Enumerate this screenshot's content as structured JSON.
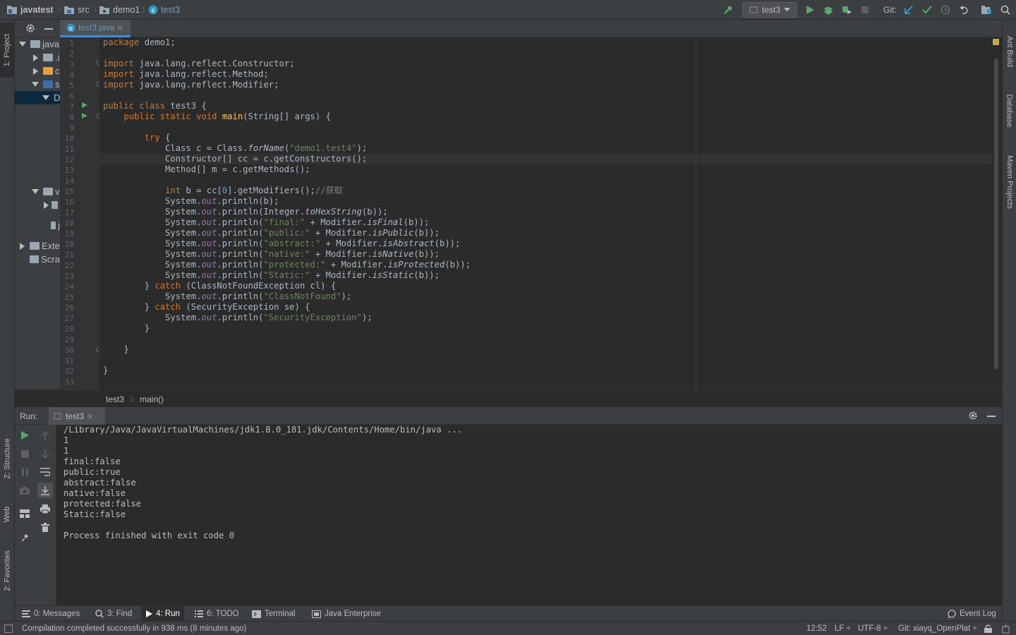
{
  "navbar": {
    "breadcrumbs": [
      "javatest",
      "src",
      "demo1",
      "test3"
    ],
    "run_config": "test3",
    "git_label": "Git:"
  },
  "left_tool_tabs": {
    "project": "1: Project",
    "structure": "Z: Structure",
    "web": "Web",
    "favorites": "2: Favorites"
  },
  "right_tool_tabs": {
    "ant": "Ant Build",
    "database": "Database",
    "maven": "Maven Projects"
  },
  "project_tree": [
    {
      "label": "java",
      "depth": 0,
      "expanded": true
    },
    {
      "label": ".i",
      "depth": 1,
      "expanded": false
    },
    {
      "label": "c",
      "depth": 1,
      "expanded": false
    },
    {
      "label": "s",
      "depth": 1,
      "expanded": true
    },
    {
      "label": "D",
      "depth": 2,
      "expanded": true,
      "selected": true
    },
    {
      "label": "v",
      "depth": 1,
      "expanded": true
    },
    {
      "label": "",
      "depth": 2,
      "expanded": false
    },
    {
      "label": "j",
      "depth": 2
    },
    {
      "label": "Exte",
      "depth": 0,
      "expanded": false
    },
    {
      "label": "Scra",
      "depth": 0
    }
  ],
  "editor": {
    "tab_label": "test3.java",
    "line_numbers": [
      "1",
      "2",
      "3",
      "4",
      "5",
      "6",
      "7",
      "8",
      "9",
      "10",
      "11",
      "12",
      "13",
      "14",
      "15",
      "16",
      "17",
      "18",
      "19",
      "20",
      "21",
      "22",
      "23",
      "24",
      "25",
      "26",
      "27",
      "28",
      "29",
      "30",
      "31",
      "32",
      "33"
    ],
    "breadcrumb": [
      "test3",
      "main()"
    ],
    "code": {
      "l1": "package demo1;",
      "l3": "import java.lang.reflect.Constructor;",
      "l4": "import java.lang.reflect.Method;",
      "l5": "import java.lang.reflect.Modifier;",
      "l7": "public class test3 {",
      "l8": "    public static void main(String[] args) {",
      "l10": "        try {",
      "l11": "            Class c = Class.forName(\"demo1.test4\");",
      "l12": "            Constructor[] cc = c.getConstructors();",
      "l13": "            Method[] m = c.getMethods();",
      "l15": "            int b = cc[0].getModifiers();//获取",
      "l16": "            System.out.println(b);",
      "l17": "            System.out.println(Integer.toHexString(b));",
      "l18": "            System.out.println(\"final:\" + Modifier.isFinal(b));",
      "l19": "            System.out.println(\"public:\" + Modifier.isPublic(b));",
      "l20": "            System.out.println(\"abstract:\" + Modifier.isAbstract(b));",
      "l21": "            System.out.println(\"native:\" + Modifier.isNative(b));",
      "l22": "            System.out.println(\"protected:\" + Modifier.isProtected(b));",
      "l23": "            System.out.println(\"Static:\" + Modifier.isStatic(b));",
      "l24": "        } catch (ClassNotFoundException cl) {",
      "l25": "            System.out.println(\"ClassNotFound\");",
      "l26": "        } catch (SecurityException se) {",
      "l27": "            System.out.println(\"SecurityException\");",
      "l28": "        }",
      "l30": "    }",
      "l32": "}"
    },
    "tokens": {
      "package": "package",
      "import": "import",
      "public": "public",
      "class": "class",
      "static": "static",
      "void": "void",
      "try": "try",
      "int": "int",
      "catch": "catch",
      "main": "main",
      "forName": "forName",
      "toHexString": "toHexString",
      "isFinal": "isFinal",
      "isPublic": "isPublic",
      "isAbstract": "isAbstract",
      "isNative": "isNative",
      "isProtected": "isProtected",
      "isStatic": "isStatic",
      "out": "out",
      "zero": "0",
      "comment": "//获取",
      "s_test4": "\"demo1.test4\"",
      "s_final": "\"final:\"",
      "s_public": "\"public:\"",
      "s_abstract": "\"abstract:\"",
      "s_native": "\"native:\"",
      "s_protected": "\"protected:\"",
      "s_static": "\"Static:\"",
      "s_cnf": "\"ClassNotFound\"",
      "s_se": "\"SecurityException\""
    }
  },
  "run_panel": {
    "title": "Run:",
    "tab": "test3",
    "output": [
      "/Library/Java/JavaVirtualMachines/jdk1.8.0_181.jdk/Contents/Home/bin/java ...",
      "1",
      "1",
      "final:false",
      "public:true",
      "abstract:false",
      "native:false",
      "protected:false",
      "Static:false",
      "",
      "Process finished with exit code 0"
    ]
  },
  "bottom_tabs": [
    "0: Messages",
    "3: Find",
    "4: Run",
    "6: TODO",
    "Terminal",
    "Java Enterprise"
  ],
  "event_log": "Event Log",
  "status": {
    "message": "Compilation completed successfully in 938 ms (8 minutes ago)",
    "position": "12:52",
    "line_sep": "LF ÷",
    "encoding": "UTF-8 ÷",
    "git_branch": "Git: xiayq_OpenPlat ÷"
  },
  "colors": {
    "bg_editor": "#2b2b2b",
    "bg_panel": "#3c3f41",
    "keyword": "#cc7832",
    "string": "#6a8759",
    "field": "#9876aa",
    "method_decl": "#ffc66d",
    "number": "#6897bb",
    "run_green": "#59a869",
    "accent_blue": "#4a88c7"
  }
}
